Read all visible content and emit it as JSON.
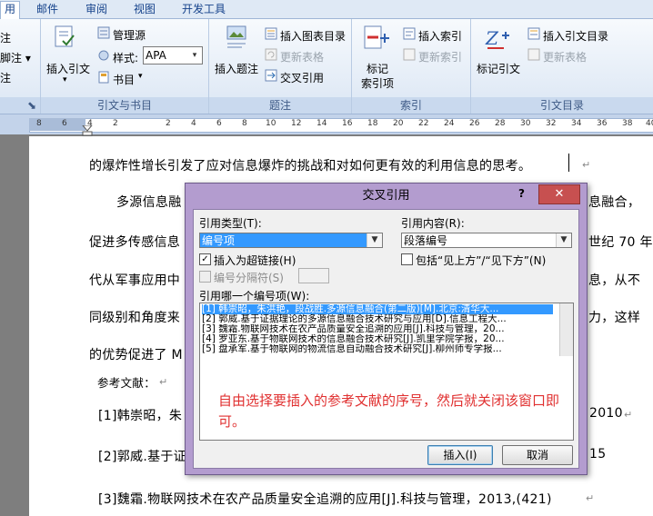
{
  "tabs": [
    {
      "label": "用",
      "active": true
    },
    {
      "label": "邮件"
    },
    {
      "label": "审阅"
    },
    {
      "label": "视图"
    },
    {
      "label": "开发工具"
    }
  ],
  "ribbon": {
    "partial_left": [
      "注",
      "脚注 ▾",
      "注"
    ],
    "citations": {
      "insert_citation": "插入引文",
      "manage_sources": "管理源",
      "style_label": "样式:",
      "style_value": "APA",
      "bibliography": "书目",
      "group_label": "引文与书目"
    },
    "captions": {
      "insert_caption": "插入题注",
      "insert_table_of_figures": "插入图表目录",
      "update_table": "更新表格",
      "cross_reference": "交叉引用",
      "group_label": "题注"
    },
    "index": {
      "mark_entry": "标记\n索引项",
      "insert_index": "插入索引",
      "update_index": "更新索引",
      "group_label": "索引"
    },
    "toa": {
      "mark_citation": "标记引文",
      "insert_toa": "插入引文目录",
      "update_table": "更新表格",
      "group_label": "引文目录"
    }
  },
  "ruler_numbers": [
    "8",
    "6",
    "4",
    "2",
    "2",
    "4",
    "6",
    "8",
    "10",
    "12",
    "14",
    "16",
    "18",
    "20",
    "22",
    "24",
    "26",
    "28",
    "30",
    "32",
    "34",
    "36",
    "38",
    "40"
  ],
  "document": {
    "lines": [
      "的爆炸性增长引发了应对信息爆炸的挑战和对如何更有效的利用信息的思考。",
      "多源信息融",
      "促进多传感信息",
      "代从军事应用中",
      "同级别和角度来",
      "的优势促进了 M",
      "参考文献：",
      "[1]韩崇昭，朱",
      "[2]郭威.基于证",
      "[3]魏霜.物联网技术在农产品质量安全追溯的应用[J].科技与管理，2013,(421)"
    ],
    "right_fragments": [
      "息融合，",
      "世纪 70 年",
      "息，从不",
      "力，这样",
      "2010",
      "15"
    ]
  },
  "dialog": {
    "title": "交叉引用",
    "help": "?",
    "close": "✕",
    "ref_type_label": "引用类型(T):",
    "ref_type_value": "编号项",
    "ref_content_label": "引用内容(R):",
    "ref_content_value": "段落编号",
    "insert_hyperlink_label": "插入为超链接(H)",
    "insert_hyperlink_checked": true,
    "include_above_below_label": "包括“见上方”/“见下方”(N)",
    "include_above_below_checked": false,
    "separator_label": "编号分隔符(S)",
    "which_label": "引用哪一个编号项(W):",
    "items": [
      "[1] 韩崇昭，朱洪艳，段战胜.多源信息融合(第二版)[M].北京:清华大...",
      "[2] 郭威.基于证据理论的多源信息融合技术研究与应用[D].信息工程大...",
      "[3] 魏霜.物联网技术在农产品质量安全追溯的应用[J].科技与管理，20...",
      "[4] 罗亚东.基于物联网技术的信息融合技术研究[J].凯里学院学报，20...",
      "[5] 盘承军.基于物联网的物流信息自动融合技术研究[J].柳州师专学报..."
    ],
    "selected_index": 0,
    "note": "自由选择要插入的参考文献的序号，然后就关闭该窗口即可。",
    "insert_button": "插入(I)",
    "cancel_button": "取消"
  },
  "colors": {
    "dialog_frame": "#b39ccf",
    "close_button": "#c75050",
    "selection": "#3399ff",
    "note_text": "#e03030"
  }
}
